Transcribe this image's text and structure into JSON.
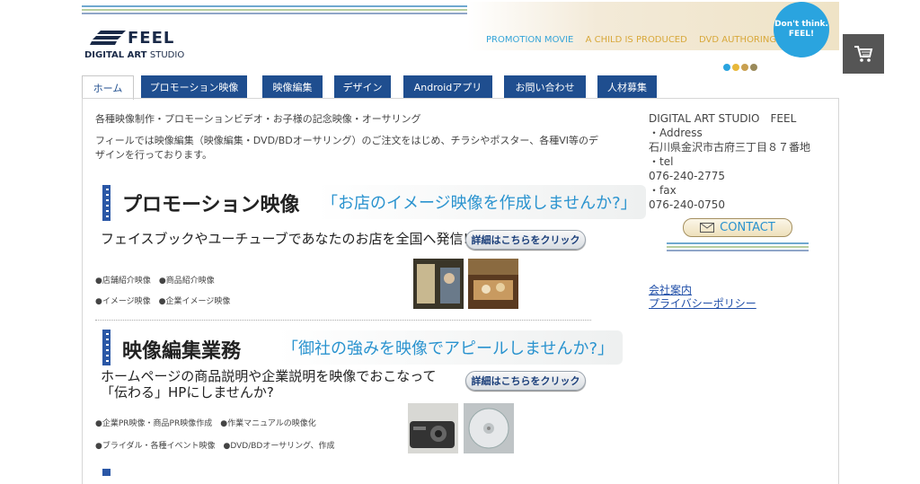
{
  "header": {
    "logo_text": "FEEL",
    "logo_sub_bold": "DIGITAL ART",
    "logo_sub_normal": "STUDIO",
    "links": [
      "PROMOTION MOVIE",
      "A CHILD IS PRODUCED",
      "DVD AUTHORING"
    ],
    "badge_line1": "Don't think.",
    "badge_line2": "FEEL!",
    "dot_colors": [
      "#2aa4df",
      "#e8b83a",
      "#c9a050",
      "#9a8a5a"
    ],
    "stripe_colors": [
      "#6fa8d0",
      "#b8cfa0",
      "#8fa6c8"
    ]
  },
  "tabs": [
    {
      "label": "ホーム",
      "active": true
    },
    {
      "label": "プロモーション映像"
    },
    {
      "label": "映像編集"
    },
    {
      "label": "デザイン"
    },
    {
      "label": "Androidアプリ"
    },
    {
      "label": "お問い合わせ"
    },
    {
      "label": "人材募集"
    }
  ],
  "intro": {
    "line1": "各種映像制作・プロモーションビデオ・お子様の記念映像・オーサリング",
    "line2": "フィールでは映像編集（映像編集・DVD/BDオーサリング）のご注文をはじめ、チラシやポスター、各種VI等のデザインを行っております。"
  },
  "sections": [
    {
      "title": "プロモーション映像",
      "catch": "「お店のイメージ映像を作成しませんか?」",
      "lead": "フェイスブックやユーチューブであなたのお店を全国へ発信!!",
      "button": "詳細はこちらをクリック",
      "bullets": [
        "●店舗紹介映像　●商品紹介映像",
        "●イメージ映像　●企業イメージ映像"
      ]
    },
    {
      "title": "映像編集業務",
      "catch": "「御社の強みを映像でアピールしませんか?」",
      "lead1": "ホームページの商品説明や企業説明を映像でおこなって",
      "lead2": "「伝わる」HPにしませんか?",
      "button": "詳細はこちらをクリック",
      "bullets": [
        "●企業PR映像・商品PR映像作成　●作業マニュアルの映像化",
        "●ブライダル・各種イベント映像　●DVD/BDオーサリング、作成"
      ]
    }
  ],
  "sidebar": {
    "company": "DIGITAL ART STUDIO　FEEL",
    "address_label": "・Address",
    "address": "石川県金沢市古府三丁目８７番地",
    "tel_label": "・tel",
    "tel": "076-240-2775",
    "fax_label": "・fax",
    "fax": "076-240-0750",
    "contact_label": "CONTACT",
    "links": [
      "会社案内",
      "プライバシーポリシー"
    ]
  }
}
